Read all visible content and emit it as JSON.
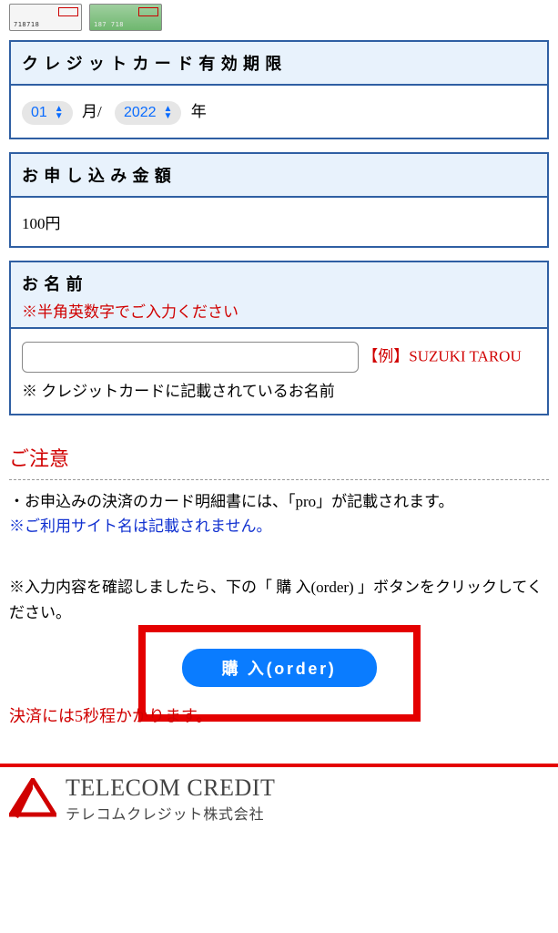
{
  "expiry": {
    "header": "クレジットカード有効期限",
    "month": "01",
    "month_suffix": "月/",
    "year": "2022",
    "year_suffix": "年"
  },
  "amount": {
    "header": "お申し込み金額",
    "value": "100円"
  },
  "name": {
    "header": "お名前",
    "hint": "※半角英数字でご入力ください",
    "example": "【例】SUZUKI TAROU",
    "note": "※ クレジットカードに記載されているお名前"
  },
  "caution": {
    "title": "ご注意",
    "line1": "・お申込みの決済のカード明細書には、「pro」が記載されます。",
    "line2": "※ご利用サイト名は記載されません。"
  },
  "instruction": "※入力内容を確認しましたら、下の「 購 入(order) 」ボタンをクリックしてください。",
  "order_button": "購 入(order)",
  "wait_note": "決済には5秒程かかります。",
  "footer": {
    "en": "TELECOM CREDIT",
    "jp": "テレコムクレジット株式会社"
  }
}
